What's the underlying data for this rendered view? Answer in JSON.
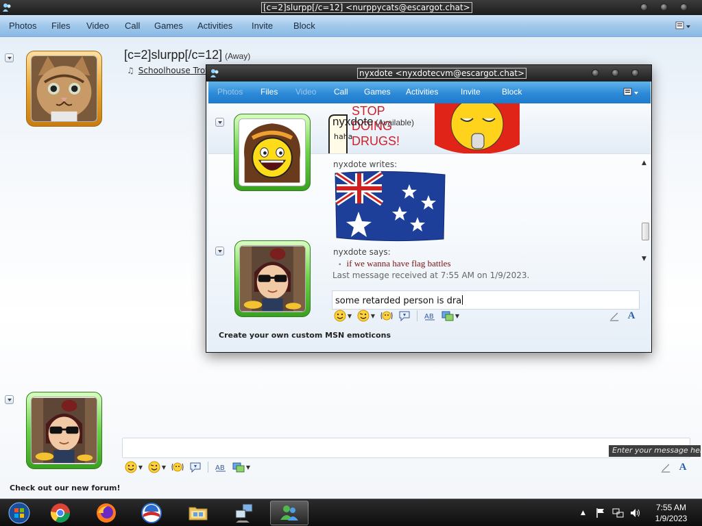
{
  "back_window": {
    "title": "[c=2]slurpp[/c=12] <nurppycats@escargot.chat>",
    "menu": [
      "Photos",
      "Files",
      "Video",
      "Call",
      "Games",
      "Activities",
      "Invite",
      "Block"
    ],
    "contact_name": "[c=2]slurpp[/c=12]",
    "contact_status": "(Away)",
    "now_playing": "Schoolhouse Trot",
    "input_hint": "Enter your message here",
    "promo": "Check out our new forum!"
  },
  "front_window": {
    "title": "nyxdote <nyxdotecvm@escargot.chat>",
    "menu": [
      "Photos",
      "Files",
      "Video",
      "Call",
      "Games",
      "Activities",
      "Invite",
      "Block"
    ],
    "contact_name": "nyxdote",
    "contact_status": "(Available)",
    "personal_message": "haha",
    "banner_text": [
      "STOP",
      "DOING",
      "DRUGS!"
    ],
    "chat": {
      "writes_line": "nyxdote writes:",
      "says_line": "nyxdote says:",
      "message": "if we wanna have flag battles",
      "last_received": "Last message received at 7:55 AM on 1/9/2023."
    },
    "input_value": "some retarded person is dra",
    "promo": "Create your own custom MSN emoticons"
  },
  "taskbar": {
    "apps": [
      "start-orb",
      "chrome",
      "firefox",
      "ie-obama",
      "file-explorer",
      "network-setup",
      "msn-messenger"
    ],
    "time": "7:55 AM",
    "date": "1/9/2023"
  },
  "colors": {
    "front_toolbar": "#2d8ad8",
    "avatar_green": "#6cd14a",
    "avatar_orange": "#e9a530",
    "message_text": "#7a1010"
  }
}
